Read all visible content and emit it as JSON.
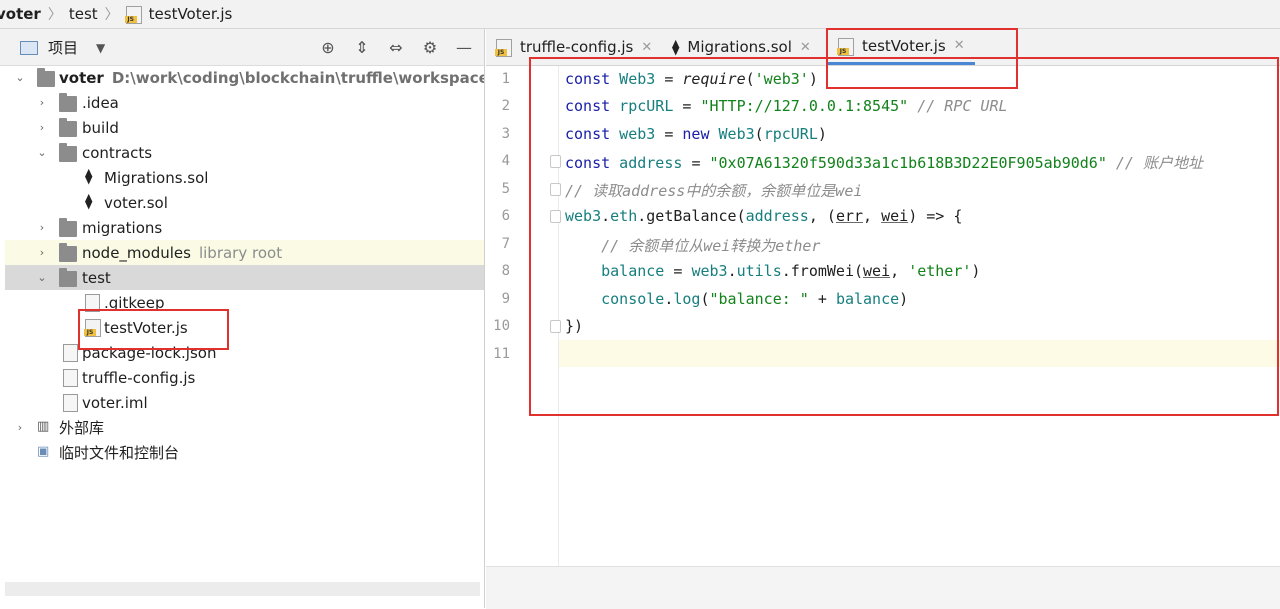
{
  "breadcrumb": [
    "voter",
    "test",
    "testVoter.js"
  ],
  "project_panel": {
    "title": "项目",
    "tree": [
      {
        "name": "voter",
        "path": "D:\\work\\coding\\blockchain\\truffle\\workspace\\voter"
      },
      {
        "name": ".idea"
      },
      {
        "name": "build"
      },
      {
        "name": "contracts"
      },
      {
        "name": "Migrations.sol"
      },
      {
        "name": "voter.sol"
      },
      {
        "name": "migrations"
      },
      {
        "name": "node_modules",
        "note": "library root"
      },
      {
        "name": "test"
      },
      {
        "name": ".gitkeep"
      },
      {
        "name": "testVoter.js"
      },
      {
        "name": "package-lock.json"
      },
      {
        "name": "truffle-config.js"
      },
      {
        "name": "voter.iml"
      },
      {
        "name": "外部库"
      },
      {
        "name": "临时文件和控制台"
      }
    ]
  },
  "tabs": [
    {
      "label": "truffle-config.js",
      "icon": "js-file-icon"
    },
    {
      "label": "Migrations.sol",
      "icon": "ethereum-icon"
    },
    {
      "label": "testVoter.js",
      "icon": "js-file-icon",
      "active": true
    }
  ],
  "editor": {
    "line_numbers": [
      "1",
      "2",
      "3",
      "4",
      "5",
      "6",
      "7",
      "8",
      "9",
      "10",
      "11"
    ],
    "current_line": 11,
    "tokens": {
      "l1": [
        "const",
        " Web3 ",
        "= ",
        "require",
        "(",
        "'web3'",
        ")"
      ],
      "l2": [
        "const",
        " rpcURL ",
        "= ",
        "\"HTTP://127.0.0.1:8545\"",
        " // RPC URL"
      ],
      "l3": [
        "const",
        " web3 ",
        "= ",
        "new",
        " Web3",
        "(",
        "rpcURL",
        ")"
      ],
      "l4": [
        "const",
        " address ",
        "= ",
        "\"0x07A61320f590d33a1c1b618B3D22E0F905ab90d6\"",
        " // 账户地址"
      ],
      "l5": [
        "// 读取address中的余额，余额单位是wei"
      ],
      "l6": [
        "web3",
        ".",
        "eth",
        ".",
        "getBalance",
        "(",
        "address",
        ", (",
        "err",
        ", ",
        "wei",
        ") => {"
      ],
      "l7": [
        "    // 余额单位从wei转换为ether"
      ],
      "l8": [
        "    ",
        "balance",
        " = ",
        "web3",
        ".",
        "utils",
        ".",
        "fromWei",
        "(",
        "wei",
        ", ",
        "'ether'",
        ")"
      ],
      "l9": [
        "    ",
        "console",
        ".",
        "log",
        "(",
        "\"balance: \"",
        " + ",
        "balance",
        ")"
      ],
      "l10": [
        "})"
      ]
    }
  },
  "colors": {
    "keyword": "#1a20a8",
    "constant": "#177e7e",
    "string": "#12821b",
    "comment": "#8c8c8c",
    "annotation_box": "#e0312f",
    "active_tab_underline": "#4a86d6"
  }
}
